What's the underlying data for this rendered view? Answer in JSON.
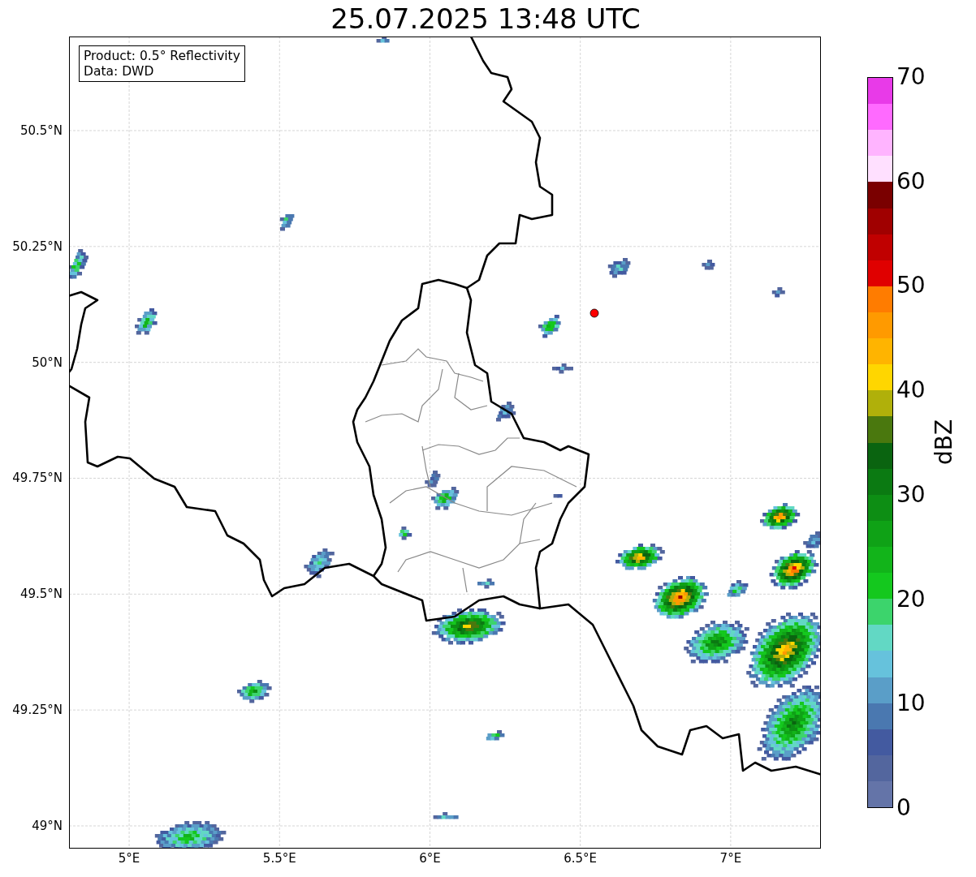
{
  "title": "25.07.2025 13:48 UTC",
  "info_box": [
    "Product: 0.5° Reflectivity",
    "Data: DWD"
  ],
  "map": {
    "xticks": [
      {
        "label": "5°E"
      },
      {
        "label": "5.5°E"
      },
      {
        "label": "6°E"
      },
      {
        "label": "6.5°E"
      },
      {
        "label": "7°E"
      }
    ],
    "yticks": [
      {
        "label": "50.5°N"
      },
      {
        "label": "50.25°N"
      },
      {
        "label": "50°N"
      },
      {
        "label": "49.75°N"
      },
      {
        "label": "49.5°N"
      },
      {
        "label": "49.25°N"
      },
      {
        "label": "49°N"
      }
    ]
  },
  "colorbar": {
    "label": "dBZ",
    "ticks": [
      "70",
      "60",
      "50",
      "40",
      "30",
      "20",
      "10",
      "0"
    ],
    "bins": [
      {
        "color": "#e83ae8"
      },
      {
        "color": "#ff6aff"
      },
      {
        "color": "#ffb4ff"
      },
      {
        "color": "#ffe0ff"
      },
      {
        "color": "#7a0000"
      },
      {
        "color": "#a00000"
      },
      {
        "color": "#c00000"
      },
      {
        "color": "#e00000"
      },
      {
        "color": "#ff7c00"
      },
      {
        "color": "#ff9a00"
      },
      {
        "color": "#ffb400"
      },
      {
        "color": "#ffd600"
      },
      {
        "color": "#b0b00a"
      },
      {
        "color": "#4a780e"
      },
      {
        "color": "#0a6410"
      },
      {
        "color": "#0b7a12"
      },
      {
        "color": "#0d8e14"
      },
      {
        "color": "#0fa216"
      },
      {
        "color": "#12b41a"
      },
      {
        "color": "#14c81e"
      },
      {
        "color": "#3cd46c"
      },
      {
        "color": "#62d8c4"
      },
      {
        "color": "#66c2dc"
      },
      {
        "color": "#5a9ec8"
      },
      {
        "color": "#4a78b0"
      },
      {
        "color": "#435aa0"
      },
      {
        "color": "#53669e"
      },
      {
        "color": "#6474a8"
      }
    ]
  }
}
